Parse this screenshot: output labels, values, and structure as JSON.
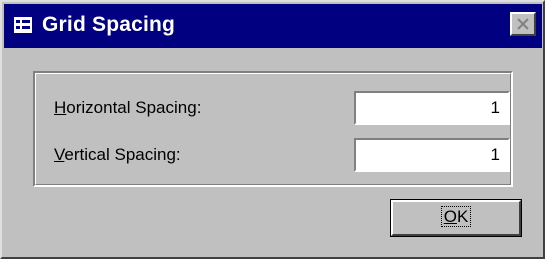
{
  "window": {
    "title": "Grid Spacing",
    "title_icon": "form-grid-icon",
    "close_icon": "close-icon"
  },
  "fields": {
    "horizontal": {
      "label_accel": "H",
      "label_rest": "orizontal Spacing:",
      "value": "1"
    },
    "vertical": {
      "label_accel": "V",
      "label_rest": "ertical Spacing:",
      "value": "1"
    }
  },
  "buttons": {
    "ok_accel": "O",
    "ok_rest": "K"
  },
  "colors": {
    "titlebar": "#000080",
    "face": "#c0c0c0"
  }
}
